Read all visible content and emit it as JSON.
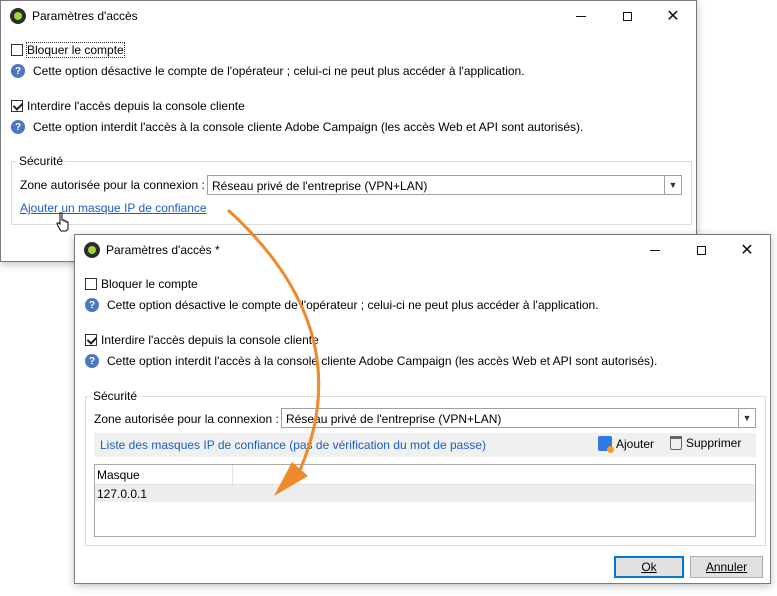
{
  "window1": {
    "title": "Paramètres d'accès",
    "block_account_label": "Bloquer le compte",
    "block_account_help": "Cette option désactive le compte de l'opérateur ; celui-ci ne peut plus accéder à l'application.",
    "forbid_console_label": "Interdire l'accès depuis la console cliente",
    "forbid_console_help": "Cette option interdit l'accès à la console cliente Adobe Campaign (les accès Web et API sont autorisés).",
    "security_group": "Sécurité",
    "zone_label": "Zone autorisée pour la connexion :",
    "zone_value": "Réseau privé de l'entreprise (VPN+LAN)",
    "add_mask_link": "Ajouter un masque IP de confiance"
  },
  "window2": {
    "title": "Paramètres d'accès *",
    "block_account_label": "Bloquer le compte",
    "block_account_help": "Cette option désactive le compte de l'opérateur ; celui-ci ne peut plus accéder à l'application.",
    "forbid_console_label": "Interdire l'accès depuis la console cliente",
    "forbid_console_help": "Cette option interdit l'accès à la console cliente Adobe Campaign (les accès Web et API sont autorisés).",
    "security_group": "Sécurité",
    "zone_label": "Zone autorisée pour la connexion :",
    "zone_value": "Réseau privé de l'entreprise (VPN+LAN)",
    "list_title": "Liste des masques IP de confiance (pas de vérification du mot de passe)",
    "add_label": "Ajouter",
    "delete_label": "Supprimer",
    "table_header": "Masque",
    "rows": [
      "127.0.0.1"
    ],
    "ok_label": "Ok",
    "cancel_label": "Annuler"
  },
  "colors": {
    "link": "#1a5ec7",
    "arrow": "#f0892a",
    "help_icon": "#4b78c0"
  }
}
